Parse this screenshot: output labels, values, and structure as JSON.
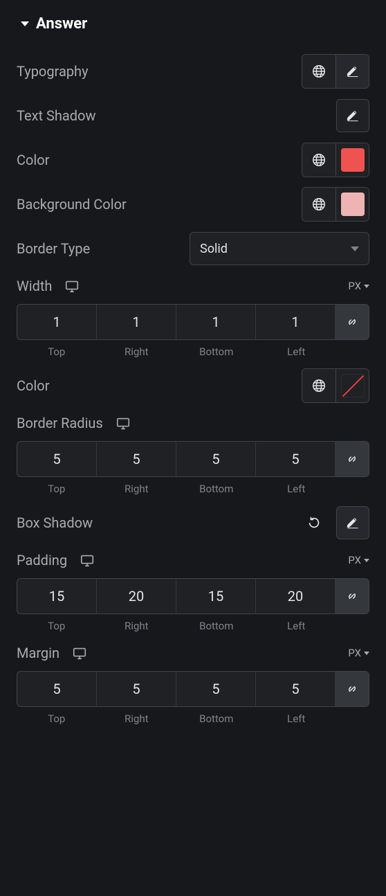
{
  "section": {
    "title": "Answer"
  },
  "typography": {
    "label": "Typography"
  },
  "text_shadow": {
    "label": "Text Shadow"
  },
  "color": {
    "label": "Color",
    "swatch": "#ef5350"
  },
  "bg_color": {
    "label": "Background Color",
    "swatch": "#eeb4b4"
  },
  "border_type": {
    "label": "Border Type",
    "value": "Solid"
  },
  "width": {
    "label": "Width",
    "unit": "PX",
    "top": "1",
    "right": "1",
    "bottom": "1",
    "left": "1",
    "sub": {
      "top": "Top",
      "right": "Right",
      "bottom": "Bottom",
      "left": "Left"
    }
  },
  "border_color": {
    "label": "Color"
  },
  "border_radius": {
    "label": "Border Radius",
    "top": "5",
    "right": "5",
    "bottom": "5",
    "left": "5",
    "sub": {
      "top": "Top",
      "right": "Right",
      "bottom": "Bottom",
      "left": "Left"
    }
  },
  "box_shadow": {
    "label": "Box Shadow"
  },
  "padding": {
    "label": "Padding",
    "unit": "PX",
    "top": "15",
    "right": "20",
    "bottom": "15",
    "left": "20",
    "sub": {
      "top": "Top",
      "right": "Right",
      "bottom": "Bottom",
      "left": "Left"
    }
  },
  "margin": {
    "label": "Margin",
    "unit": "PX",
    "top": "5",
    "right": "5",
    "bottom": "5",
    "left": "5",
    "sub": {
      "top": "Top",
      "right": "Right",
      "bottom": "Bottom",
      "left": "Left"
    }
  }
}
